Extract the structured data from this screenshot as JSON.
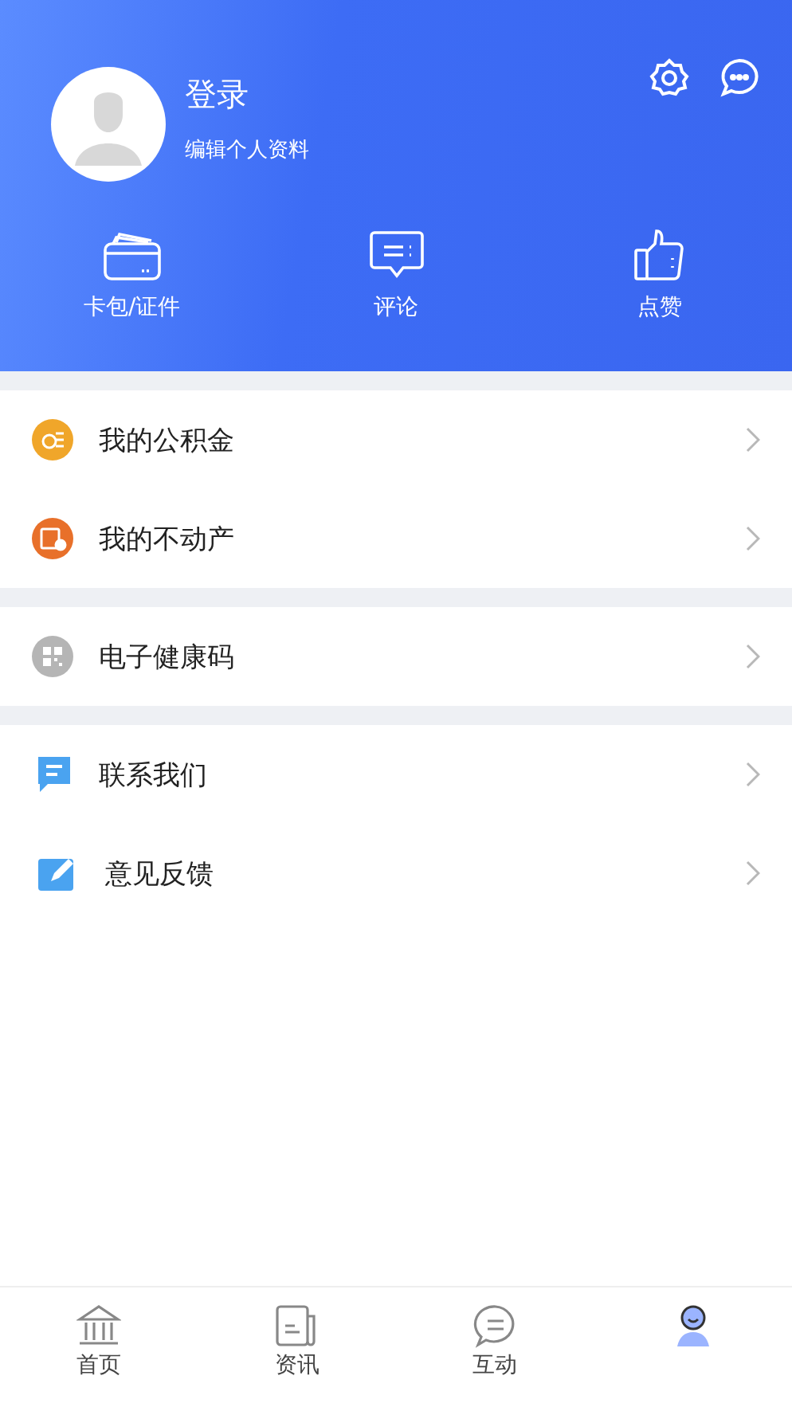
{
  "profile": {
    "name": "登录",
    "subtitle": "编辑个人资料"
  },
  "header_actions": [
    {
      "kind": "settings"
    },
    {
      "kind": "message"
    }
  ],
  "shortcuts": [
    {
      "kind": "wallet",
      "label": "卡包/证件"
    },
    {
      "kind": "comment",
      "label": "评论"
    },
    {
      "kind": "like",
      "label": "点赞"
    }
  ],
  "menu_groups": [
    [
      {
        "kind": "fund",
        "label": "我的公积金"
      },
      {
        "kind": "property",
        "label": "我的不动产"
      }
    ],
    [
      {
        "kind": "health",
        "label": "电子健康码"
      }
    ],
    [
      {
        "kind": "contact",
        "label": "联系我们"
      },
      {
        "kind": "feedback",
        "label": "意见反馈"
      }
    ]
  ],
  "tab_bar": [
    {
      "kind": "home",
      "label": "首页",
      "selected": false
    },
    {
      "kind": "news",
      "label": "资讯",
      "selected": false
    },
    {
      "kind": "chat",
      "label": "互动",
      "selected": false
    },
    {
      "kind": "me",
      "selected": true
    }
  ]
}
